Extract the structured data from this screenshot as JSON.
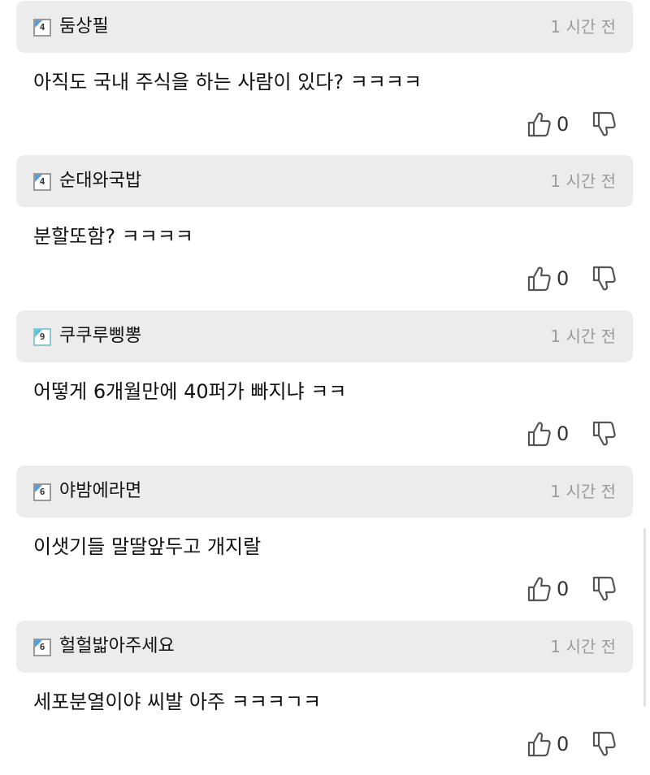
{
  "comments": [
    {
      "level": "4",
      "username": "둠상필",
      "time": "1 시간 전",
      "text": "아직도 국내 주식을 하는 사람이 있다? ㅋㅋㅋㅋ",
      "likes": "0"
    },
    {
      "level": "4",
      "username": "순대와국밥",
      "time": "1 시간 전",
      "text": "분할또함? ㅋㅋㅋㅋ",
      "likes": "0"
    },
    {
      "level": "9",
      "username": "쿠쿠루삥뽕",
      "time": "1 시간 전",
      "text": "어떻게 6개월만에 40퍼가 빠지냐 ㅋㅋ",
      "likes": "0"
    },
    {
      "level": "6",
      "username": "야밤에라면",
      "time": "1 시간 전",
      "text": "이샛기들 말딸앞두고 개지랄",
      "likes": "0"
    },
    {
      "level": "6",
      "username": "헐헐밟아주세요",
      "time": "1 시간 전",
      "text": "세포분열이야 씨발 아주 ㅋㅋㅋㄱㅋ",
      "likes": "0"
    }
  ],
  "icons": {
    "like": "thumbs-up-icon",
    "dislike": "thumbs-down-icon",
    "level": "level-badge-icon"
  }
}
